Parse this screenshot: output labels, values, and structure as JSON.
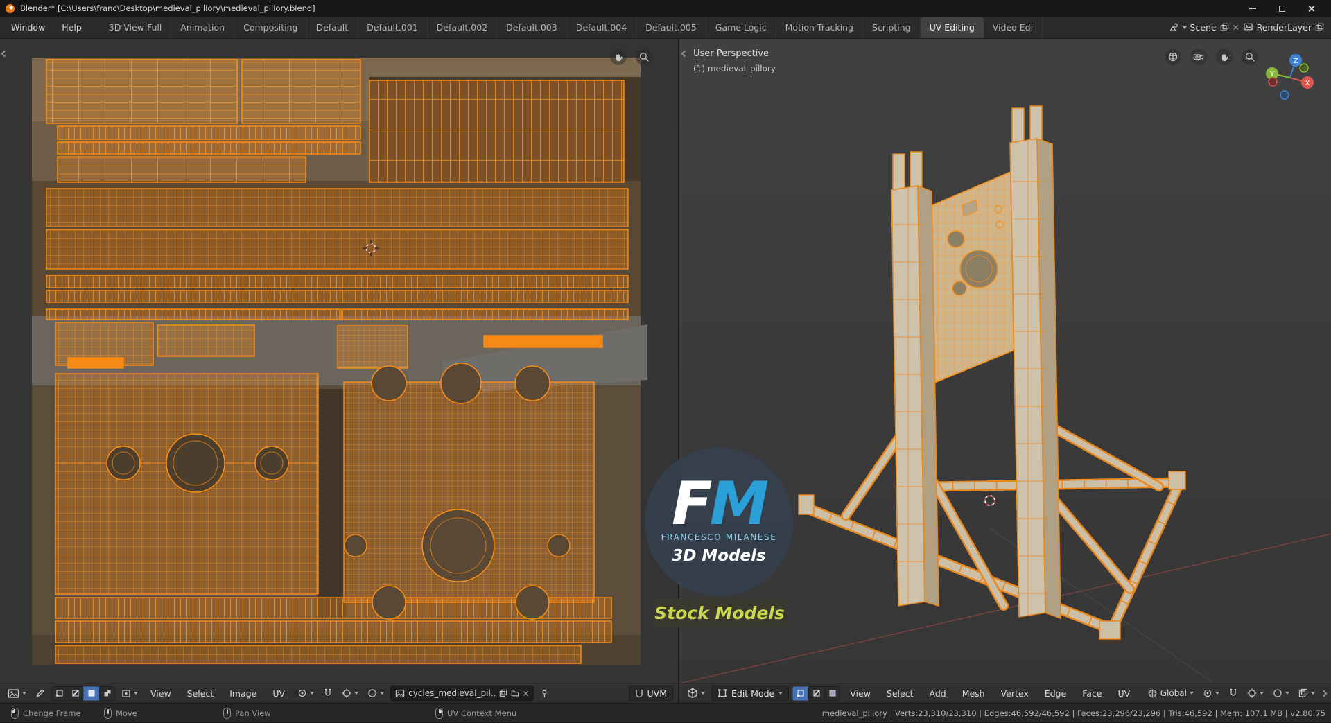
{
  "colors": {
    "orange": "#f7921e",
    "blue_accent": "#4772b3",
    "logo_blue": "#2a9fd8",
    "logo_name": "#8fd0ea",
    "badge_text": "#c9d74d"
  },
  "titlebar": {
    "title": "Blender* [C:\\Users\\franc\\Desktop\\medieval_pillory\\medieval_pillory.blend]"
  },
  "topbar": {
    "menus": [
      "Window",
      "Help"
    ],
    "tabs": [
      "3D View Full",
      "Animation",
      "Compositing",
      "Default",
      "Default.001",
      "Default.002",
      "Default.003",
      "Default.004",
      "Default.005",
      "Game Logic",
      "Motion Tracking",
      "Scripting",
      "UV Editing",
      "Video Edi"
    ],
    "active_tab": "UV Editing",
    "scene": "Scene",
    "render_layer": "RenderLayer"
  },
  "uv_editor": {
    "menus": [
      "View",
      "Select",
      "Image",
      "UV"
    ],
    "image_name": "cycles_medieval_pil..",
    "uv_map": "UVM"
  },
  "viewport": {
    "overlay": [
      "User Perspective",
      "(1) medieval_pillory"
    ],
    "mode": "Edit Mode",
    "menus": [
      "View",
      "Select",
      "Add",
      "Mesh",
      "Vertex",
      "Edge",
      "Face",
      "UV"
    ],
    "orientation": "Global",
    "axis": {
      "x": "X",
      "y": "Y",
      "z": "Z"
    }
  },
  "watermark": {
    "f": "F",
    "m": "M",
    "name": "FRANCESCO MILANESE",
    "line": "3D Models",
    "badge": "Stock Models"
  },
  "statusbar": {
    "hints": [
      {
        "label": "Change Frame"
      },
      {
        "label": "Move"
      },
      {
        "label": "Pan View"
      },
      {
        "label": "UV Context Menu"
      }
    ],
    "stats": "medieval_pillory | Verts:23,310/23,310 | Edges:46,592/46,592 | Faces:23,296/23,296 | Tris:46,592 | Mem: 107.1 MB | v2.80.75"
  }
}
